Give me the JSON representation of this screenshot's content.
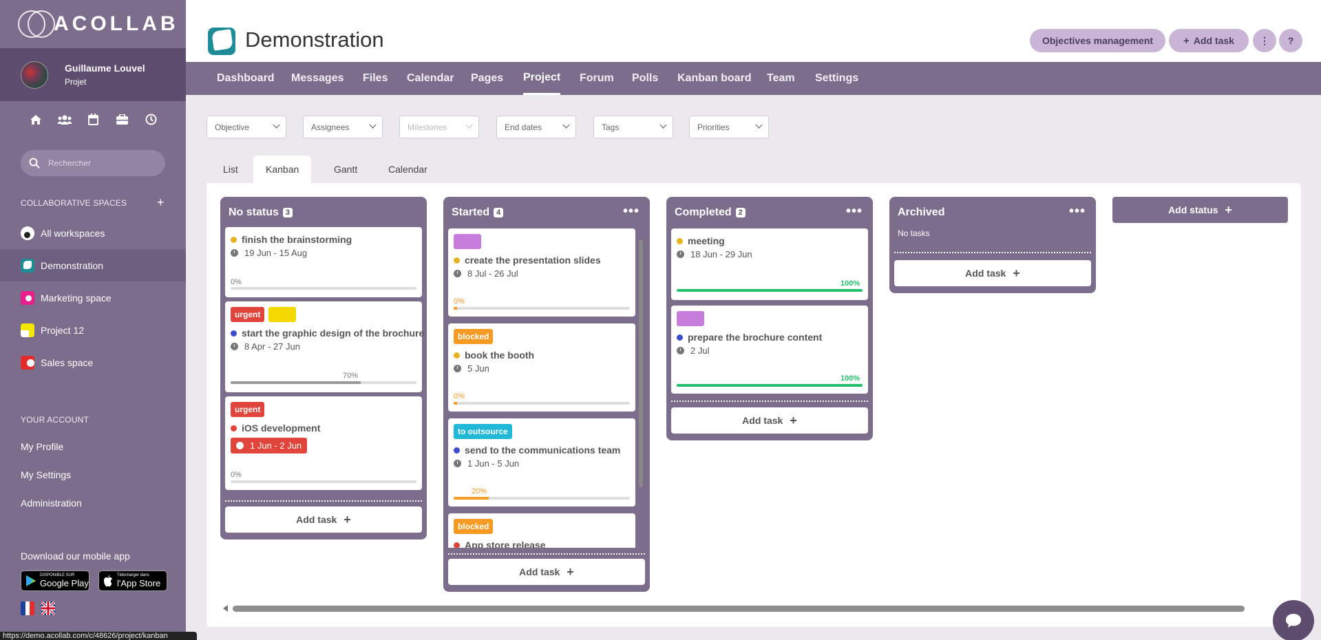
{
  "sidebar": {
    "logo_text": "ACOLLAB",
    "user": {
      "name": "Guillaume Louvel",
      "role": "Projet"
    },
    "search_placeholder": "Rechercher",
    "collab_label": "COLLABORATIVE SPACES",
    "workspaces": [
      {
        "label": "All workspaces"
      },
      {
        "label": "Demonstration"
      },
      {
        "label": "Marketing space"
      },
      {
        "label": "Project 12"
      },
      {
        "label": "Sales space"
      }
    ],
    "account_label": "YOUR ACCOUNT",
    "account_items": [
      "My Profile",
      "My Settings",
      "Administration"
    ],
    "download_label": "Download our mobile app",
    "google_small": "DISPONIBLE SUR",
    "google_big": "Google Play",
    "apple_small": "Télécharger dans",
    "apple_big": "l'App Store",
    "status_url": "https://demo.acollab.com/c/48626/project/kanban"
  },
  "header": {
    "title": "Demonstration",
    "objectives_btn": "Objectives management",
    "add_task_btn": "Add task",
    "more_btn": "⋮",
    "help_btn": "?"
  },
  "nav": [
    "Dashboard",
    "Messages",
    "Files",
    "Calendar",
    "Pages",
    "Project",
    "Forum",
    "Polls",
    "Kanban board",
    "Team",
    "Settings"
  ],
  "filters": [
    "Objective",
    "Assignees",
    "Milestones",
    "End dates",
    "Tags",
    "Priorities"
  ],
  "view_tabs": [
    "List",
    "Kanban",
    "Gantt",
    "Calendar"
  ],
  "board": {
    "add_task_label": "Add task",
    "add_status_label": "Add status",
    "no_tasks_label": "No tasks",
    "columns": [
      {
        "name": "No status",
        "count": "3",
        "cards": [
          {
            "title": "finish the brainstorming",
            "dates": "19 Jun - 15 Aug",
            "progress": "0%",
            "dot": "#e6b422"
          },
          {
            "tag1": "urgent",
            "title": "start the graphic design of the brochure",
            "dates": "8 Apr - 27 Jun",
            "progress": "70%",
            "dot": "#3d4ccf"
          },
          {
            "tag1": "urgent",
            "title": "iOS development",
            "dates": "1 Jun - 2 Jun",
            "progress": "0%",
            "dot": "#e0443a"
          }
        ]
      },
      {
        "name": "Started",
        "count": "4",
        "cards": [
          {
            "title": "create the presentation slides",
            "dates": "8 Jul - 26 Jul",
            "progress": "0%",
            "dot": "#e6b422"
          },
          {
            "tag1": "blocked",
            "title": "book the booth",
            "dates": "5 Jun",
            "progress": "0%",
            "dot": "#e6b422"
          },
          {
            "tag1": "to outsource",
            "title": "send to the communications team",
            "dates": "1 Jun - 5 Jun",
            "progress": "20%",
            "dot": "#3d4ccf"
          },
          {
            "tag1": "blocked",
            "title": "App store release",
            "dot": "#e0443a"
          }
        ]
      },
      {
        "name": "Completed",
        "count": "2",
        "cards": [
          {
            "title": "meeting",
            "dates": "18 Jun - 29 Jun",
            "progress": "100%",
            "dot": "#e6b422"
          },
          {
            "title": "prepare the brochure content",
            "dates": "2 Jul",
            "progress": "100%",
            "dot": "#3d4ccf"
          }
        ]
      },
      {
        "name": "Archived"
      }
    ]
  },
  "colors": {
    "sidebar": "#7d6d8d",
    "urgent": "#e0443a",
    "blocked": "#f59a23",
    "outsource": "#22b8d8",
    "purple_tag": "#c77ddb",
    "yellow_tag": "#f5d800",
    "complete": "#22c06a"
  }
}
